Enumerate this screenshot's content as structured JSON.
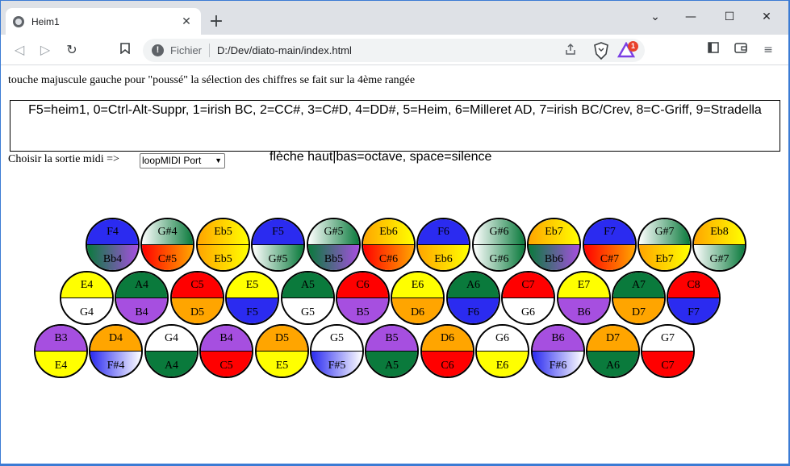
{
  "browser": {
    "tab_title": "Heim1",
    "tab_close": "✕",
    "new_tab": "+",
    "window_controls": {
      "minimize": "—",
      "maximize": "☐",
      "close": "✕"
    },
    "omnibox": {
      "info": "!",
      "scheme_label": "Fichier",
      "url": "D:/Dev/diato-main/index.html"
    },
    "rewards_badge": "1"
  },
  "page": {
    "instruction": "touche majuscule gauche pour \"poussé\" la sélection des chiffres se fait sur la 4ème rangée",
    "mapping": "F5=heim1, 0=Ctrl-Alt-Suppr, 1=irish BC, 2=CC#, 3=C#D, 4=DD#, 5=Heim, 6=Milleret AD, 7=irish BC/Crev, 8=C-Griff, 9=Stradella",
    "midi_label": "Choisir la sortie midi =>",
    "midi_selected": "loopMIDI Port",
    "keys_hint": "flèche haut|bas=octave, space=silence"
  },
  "colors": {
    "C": "#ff0000",
    "D": "#ffa500",
    "E": "#ffff00",
    "F": "#2b2bf0",
    "G": "#ffffff",
    "A": "#0a7a3c",
    "B": "#a64fe0",
    "C#": [
      "#ff0000",
      "#ffa500"
    ],
    "D#": [
      "#ffa500",
      "#ffff00"
    ],
    "Eb": [
      "#ffa500",
      "#ffff00"
    ],
    "F#": [
      "#2b2bf0",
      "#ffffff"
    ],
    "G#": [
      "#ffffff",
      "#0a7a3c"
    ],
    "Bb": [
      "#0a7a3c",
      "#a64fe0"
    ]
  },
  "rows": [
    [
      {
        "top": "F4",
        "bottom": "Bb4"
      },
      {
        "top": "G#4",
        "bottom": "C#5"
      },
      {
        "top": "Eb5",
        "bottom": "Eb5"
      },
      {
        "top": "F5",
        "bottom": "G#5"
      },
      {
        "top": "G#5",
        "bottom": "Bb5"
      },
      {
        "top": "Eb6",
        "bottom": "C#6"
      },
      {
        "top": "F6",
        "bottom": "Eb6"
      },
      {
        "top": "G#6",
        "bottom": "G#6"
      },
      {
        "top": "Eb7",
        "bottom": "Bb6"
      },
      {
        "top": "F7",
        "bottom": "C#7"
      },
      {
        "top": "G#7",
        "bottom": "Eb7"
      },
      {
        "top": "Eb8",
        "bottom": "G#7"
      }
    ],
    [
      {
        "top": "E4",
        "bottom": "G4"
      },
      {
        "top": "A4",
        "bottom": "B4"
      },
      {
        "top": "C5",
        "bottom": "D5"
      },
      {
        "top": "E5",
        "bottom": "F5"
      },
      {
        "top": "A5",
        "bottom": "G5"
      },
      {
        "top": "C6",
        "bottom": "B5"
      },
      {
        "top": "E6",
        "bottom": "D6"
      },
      {
        "top": "A6",
        "bottom": "F6"
      },
      {
        "top": "C7",
        "bottom": "G6"
      },
      {
        "top": "E7",
        "bottom": "B6"
      },
      {
        "top": "A7",
        "bottom": "D7"
      },
      {
        "top": "C8",
        "bottom": "F7"
      }
    ],
    [
      {
        "top": "B3",
        "bottom": "E4"
      },
      {
        "top": "D4",
        "bottom": "F#4"
      },
      {
        "top": "G4",
        "bottom": "A4"
      },
      {
        "top": "B4",
        "bottom": "C5"
      },
      {
        "top": "D5",
        "bottom": "E5"
      },
      {
        "top": "G5",
        "bottom": "F#5"
      },
      {
        "top": "B5",
        "bottom": "A5"
      },
      {
        "top": "D6",
        "bottom": "C6"
      },
      {
        "top": "G6",
        "bottom": "E6"
      },
      {
        "top": "B6",
        "bottom": "F#6"
      },
      {
        "top": "D7",
        "bottom": "A6"
      },
      {
        "top": "G7",
        "bottom": "C7"
      }
    ]
  ]
}
